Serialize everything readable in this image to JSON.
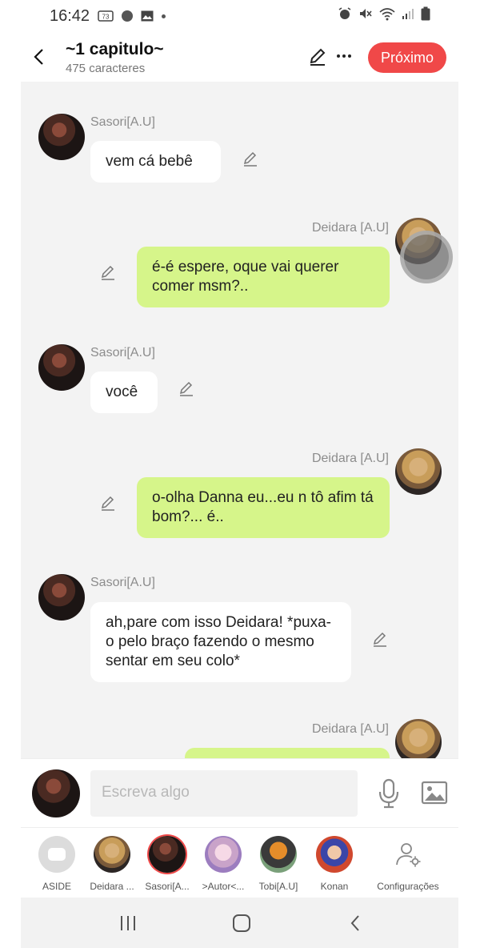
{
  "status_bar": {
    "time": "16:42",
    "notification_badge": "73",
    "icons": [
      "alarm-icon",
      "mute-icon",
      "wifi-icon",
      "signal-icon",
      "battery-icon"
    ]
  },
  "header": {
    "title": "~1 capitulo~",
    "subtitle": "475 caracteres",
    "next_label": "Próximo"
  },
  "messages": [
    {
      "side": "left",
      "sender": "Sasori[A.U]",
      "text": "vem cá  bebê"
    },
    {
      "side": "right",
      "sender": "Deidara [A.U]",
      "text": "é-é espere, oque vai querer comer msm?.."
    },
    {
      "side": "left",
      "sender": "Sasori[A.U]",
      "text": "você"
    },
    {
      "side": "right",
      "sender": "Deidara [A.U]",
      "text": "o-olha  Danna eu...eu n tô afim tá bom?... é.."
    },
    {
      "side": "left",
      "sender": "Sasori[A.U]",
      "text": "ah,pare com isso Deidara! *puxa-o pelo braço  fazendo  o mesmo sentar em seu colo*"
    },
    {
      "side": "right",
      "sender": "Deidara [A.U]",
      "text": ""
    }
  ],
  "composer": {
    "placeholder": "Escreva algo"
  },
  "characters": [
    {
      "name": "ASIDE"
    },
    {
      "name": "Deidara ..."
    },
    {
      "name": "Sasori[A..."
    },
    {
      "name": ">Autor<..."
    },
    {
      "name": "Tobi[A.U]"
    },
    {
      "name": "Konan"
    },
    {
      "name": "Configurações"
    }
  ],
  "colors": {
    "accent": "#f04848",
    "bubble_right": "#d6f58a",
    "bubble_left": "#ffffff",
    "chat_bg": "#f3f3f3"
  }
}
